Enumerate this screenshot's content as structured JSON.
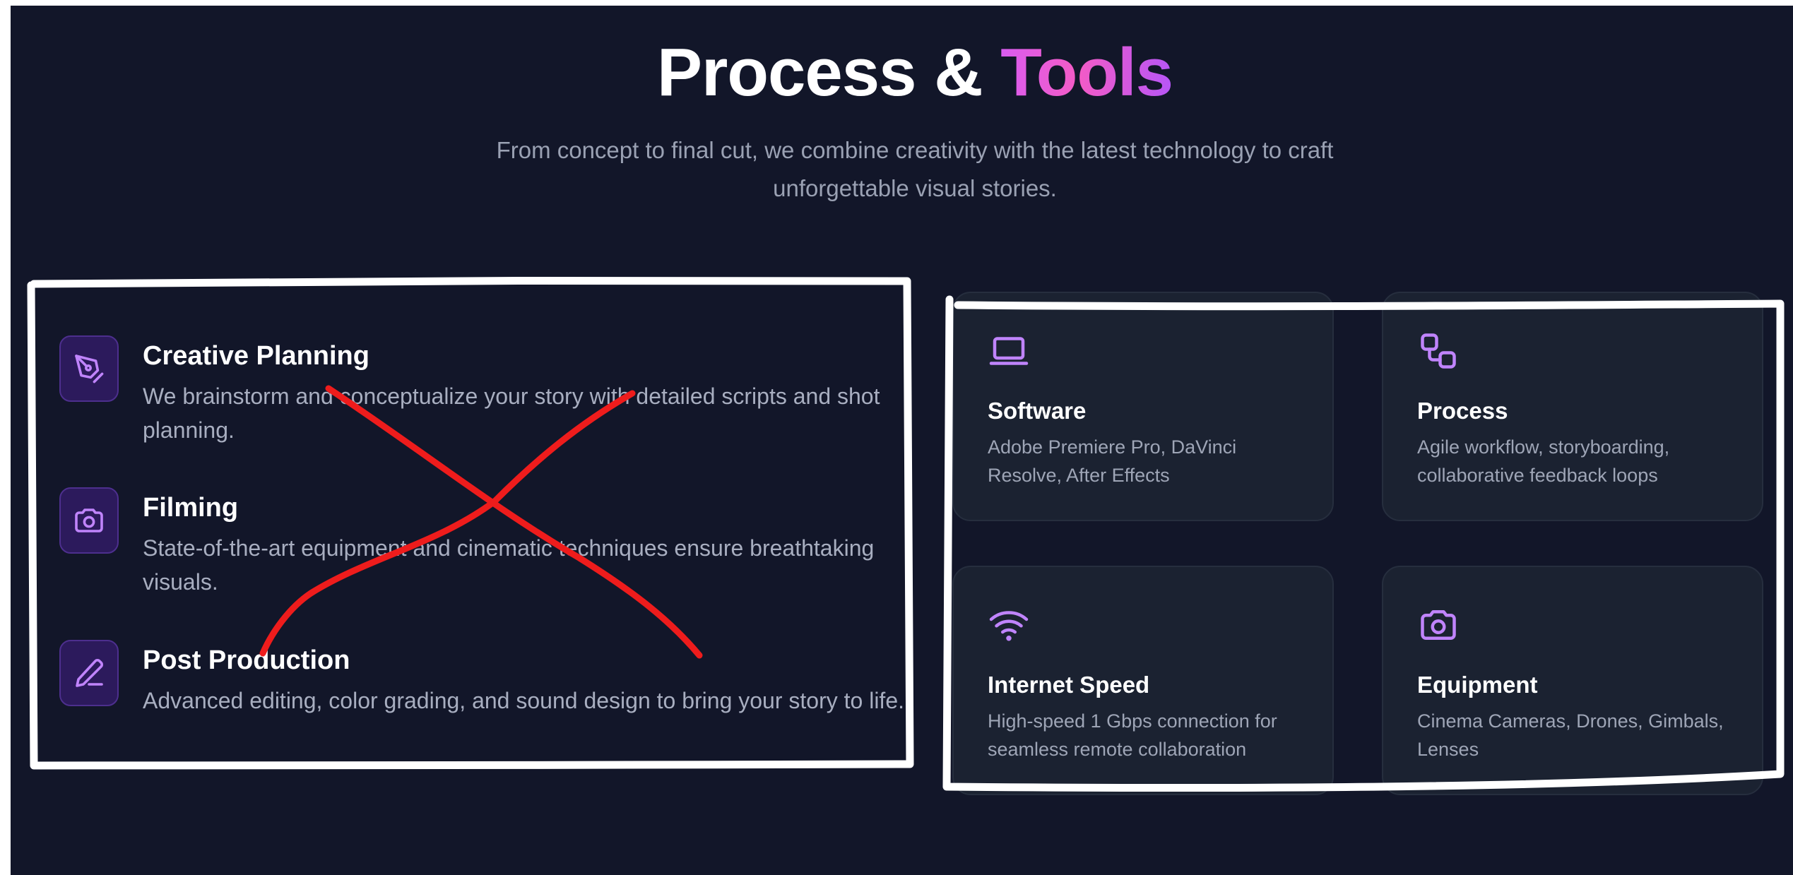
{
  "header": {
    "title_main": "Process &",
    "title_accent": "Tools",
    "subtitle_line1": "From concept to final cut, we combine creativity with the latest technology to craft",
    "subtitle_line2": "unforgettable visual stories."
  },
  "process": [
    {
      "icon": "pen-tool-icon",
      "title": "Creative Planning",
      "desc": "We brainstorm and conceptualize your story with detailed scripts and shot planning."
    },
    {
      "icon": "camera-icon",
      "title": "Filming",
      "desc": "State-of-the-art equipment and cinematic techniques ensure breathtaking visuals."
    },
    {
      "icon": "pencil-icon",
      "title": "Post Production",
      "desc": "Advanced editing, color grading, and sound design to bring your story to life."
    }
  ],
  "tools": [
    {
      "icon": "laptop-icon",
      "title": "Software",
      "desc": "Adobe Premiere Pro, DaVinci Resolve, After Effects"
    },
    {
      "icon": "workflow-icon",
      "title": "Process",
      "desc": "Agile workflow, storyboarding, collaborative feedback loops"
    },
    {
      "icon": "wifi-icon",
      "title": "Internet Speed",
      "desc": "High-speed 1 Gbps connection for seamless remote collaboration"
    },
    {
      "icon": "camera-icon",
      "title": "Equipment",
      "desc": "Cinema Cameras, Drones, Gimbals, Lenses"
    }
  ],
  "colors": {
    "background": "#121629",
    "accent_purple": "#a855f7",
    "accent_pink": "#ec4899",
    "card_bg": "#1b2231",
    "annotation_white": "#ffffff",
    "annotation_red": "#ee1c1c"
  }
}
